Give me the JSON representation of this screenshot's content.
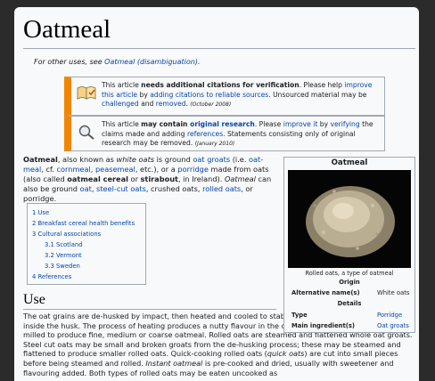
{
  "article": {
    "title": "Oatmeal",
    "hatnote": {
      "prefix": "For other uses, see ",
      "link": "Oatmeal (disambiguation)",
      "suffix": "."
    }
  },
  "notices": [
    {
      "p1": "This article ",
      "bold": "needs additional citations for verification",
      "p2": ". Please help ",
      "link1": "improve this article",
      "p3": " by ",
      "link2": "adding citations to reliable sources",
      "p4": ". Unsourced material may be ",
      "link3": "challenged",
      "p5": " and ",
      "link4": "removed",
      "p6": ".",
      "date": "(October 2008)"
    },
    {
      "p1": "This article ",
      "bold": "may contain ",
      "boldlink": "original research",
      "p2": ". Please ",
      "link1": "improve it",
      "p3": " by ",
      "link2": "verifying",
      "p4": " the claims made and adding ",
      "link3": "references",
      "p5": ". Statements consisting only of original research may be removed.",
      "date": "(January 2010)"
    }
  ],
  "intro": {
    "b1": "Oatmeal",
    "t1": ", also known as ",
    "i1": "white oats",
    "t2": " is ground ",
    "l1": "oat groats",
    "t3": " (i.e. ",
    "l2": "oat-meal",
    "t4": ", cf. ",
    "l3": "cornmeal",
    "t5": ", ",
    "l4": "peasemeal",
    "t6": ", etc.), or a ",
    "l5": "porridge",
    "t7": " made from oats (also called ",
    "b2": "oatmeal cereal",
    "t8": " or ",
    "b3": "stirabout",
    "t9": ", in Ireland). ",
    "i2": "Oatmeal",
    "t10": " can also be ground ",
    "l6": "oat",
    "t11": ", ",
    "l7": "steel-cut oats",
    "t12": ", crushed oats, ",
    "l8": "rolled oats",
    "t13": ", or porridge."
  },
  "toc": [
    {
      "label": "1 Use",
      "sub": false
    },
    {
      "label": "2 Breakfast cereal health benefits",
      "sub": false
    },
    {
      "label": "3 Cultural associations",
      "sub": false
    },
    {
      "label": "3.1 Scotland",
      "sub": true
    },
    {
      "label": "3.2 Vermont",
      "sub": true
    },
    {
      "label": "3.3 Sweden",
      "sub": true
    },
    {
      "label": "4 References",
      "sub": false
    }
  ],
  "section_use": {
    "heading": "Use",
    "s1": "The oat grains are de-husked by impact, then heated and cooled to stabilize the \"Oat groats\", the seed inside the husk. The process of heating produces a nutty flavour in the oats. These oat groats may be milled to produce fine, medium or coarse oatmeal. Rolled oats are steamed and flattened whole oat groats. Steel cut oats may be small and broken groats from the de-husking process; these may be steamed and flattened to produce smaller rolled oats. Quick-cooking rolled oats (",
    "i1": "quick oats",
    "s2": ") are cut into small pieces before being steamed and rolled. ",
    "i2": "Instant oatmeal",
    "s3": " is pre-cooked and dried, usually with sweetener and flavouring added. Both types of rolled oats may be eaten uncooked as"
  },
  "infobox": {
    "title": "Oatmeal",
    "caption": "Rolled oats, a type of oatmeal",
    "section_origin": "Origin",
    "alt_names_label": "Alternative name(s)",
    "alt_names_value": "White oats",
    "section_details": "Details",
    "type_label": "Type",
    "type_value": "Porridge",
    "ingredient_label": "Main ingredient(s)",
    "ingredient_value": "Oat groats"
  },
  "colors": {
    "link": "#0645ad",
    "notice_accent": "#f28500",
    "background": "#f8f9fa",
    "border": "#a2a9b1"
  },
  "icons": {
    "notice_1": "book-icon",
    "notice_2": "magnifier-icon"
  }
}
